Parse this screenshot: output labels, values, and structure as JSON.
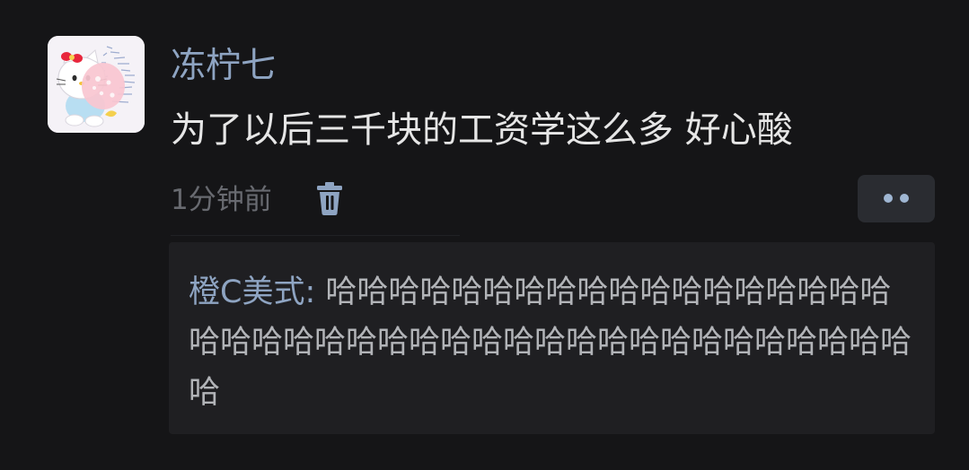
{
  "comment": {
    "username": "冻柠七",
    "text": "为了以后三千块的工资学这么多 好心酸",
    "time": "1分钟前"
  },
  "icons": {
    "avatar": "hello-kitty-avatar",
    "delete": "trash-icon",
    "more": "more-dots-icon"
  },
  "reply": {
    "author": "橙C美式:",
    "text": " 哈哈哈哈哈哈哈哈哈哈哈哈哈哈哈哈哈哈哈哈哈哈哈哈哈哈哈哈哈哈哈哈哈哈哈哈哈哈哈哈哈哈"
  },
  "colors": {
    "background": "#151517",
    "username": "#8ea4c2",
    "text": "#e6e6e6",
    "muted": "#686a70",
    "reply_background": "#1f1f22"
  }
}
